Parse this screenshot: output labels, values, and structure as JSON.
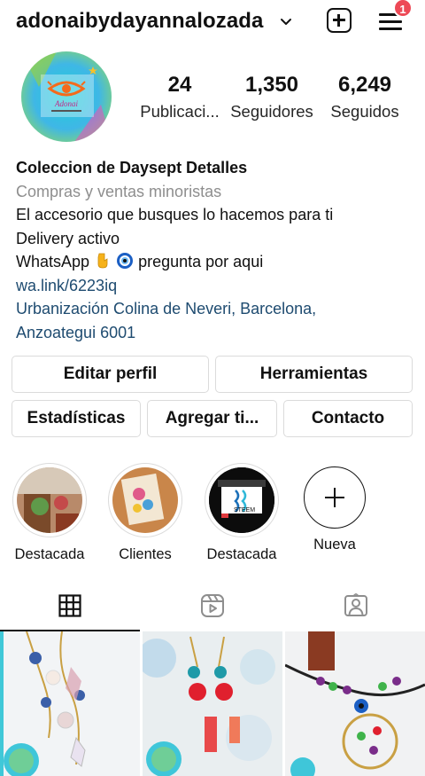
{
  "header": {
    "username": "adonaibydayannalozada",
    "notification_count": "1"
  },
  "stats": [
    {
      "value": "24",
      "label": "Publicaci..."
    },
    {
      "value": "1,350",
      "label": "Seguidores"
    },
    {
      "value": "6,249",
      "label": "Seguidos"
    }
  ],
  "bio": {
    "name": "Coleccion de Daysept Detalles",
    "category": "Compras y ventas minoristas",
    "line1": "El accesorio que busques lo hacemos para ti",
    "line2": "Delivery activo",
    "line3_text": "WhatsApp",
    "line3_rest": "pregunta por aqui",
    "link": "wa.link/6223iq",
    "address_line1": "Urbanización Colina de Neveri, Barcelona,",
    "address_line2": "Anzoategui 6001"
  },
  "buttons": {
    "edit_profile": "Editar perfil",
    "tools": "Herramientas",
    "stats": "Estadísticas",
    "add": "Agregar ti...",
    "contact": "Contacto"
  },
  "highlights": [
    {
      "label": "Destacada"
    },
    {
      "label": "Clientes"
    },
    {
      "label": "Destacada",
      "badge_text": "STEEM"
    },
    {
      "label": "Nueva"
    }
  ],
  "avatar_text": "Adonai",
  "colors": {
    "link": "#1e4b70",
    "category": "#8e8e8e",
    "badge": "#ed4956",
    "border": "#dbdbdb"
  },
  "tabs": [
    {
      "icon": "grid-icon",
      "active": true
    },
    {
      "icon": "reels-icon",
      "active": false
    },
    {
      "icon": "tagged-icon",
      "active": false
    }
  ]
}
